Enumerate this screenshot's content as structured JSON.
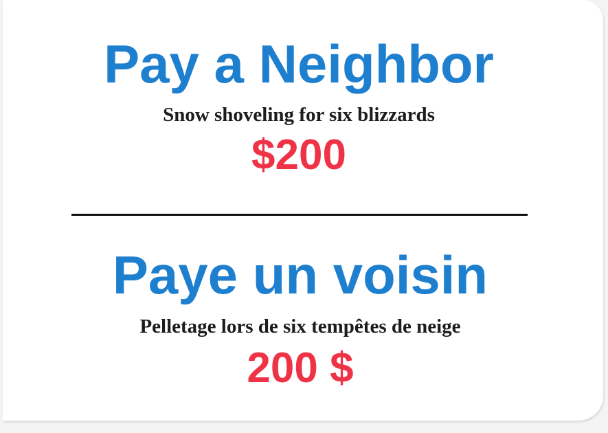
{
  "english": {
    "title": "Pay a Neighbor",
    "description": "Snow shoveling for six blizzards",
    "amount": "$200"
  },
  "french": {
    "title": "Paye un voisin",
    "description": "Pelletage lors de six tempêtes de neige",
    "amount": "200 $"
  },
  "colors": {
    "title": "#1e7fcf",
    "amount": "#ef3347",
    "text": "#1c1c1c",
    "card": "#ffffff"
  }
}
